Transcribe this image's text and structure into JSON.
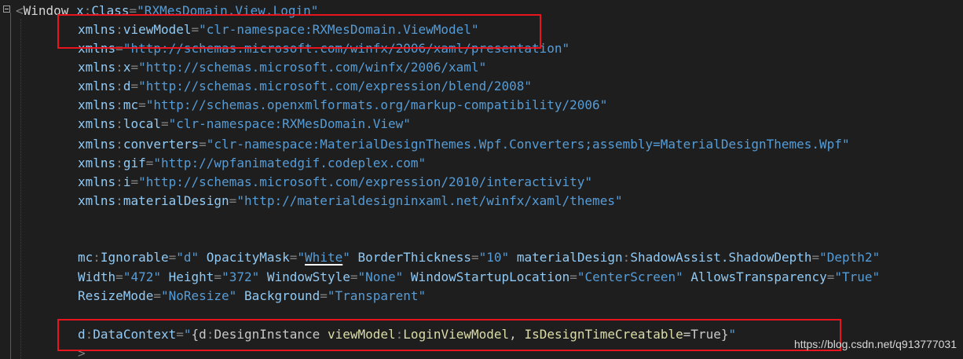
{
  "editor": {
    "first_line": {
      "open": "<",
      "element": "Window",
      "attr_prefix": "x",
      "colon": ":",
      "attr_name": "Class",
      "eq": "=",
      "value": "\"RXMesDomain.View.Login\""
    },
    "namespaces": [
      {
        "prefix": "xmlns",
        "name": "viewModel",
        "value": "\"clr-namespace:RXMesDomain.ViewModel\""
      },
      {
        "prefix": "xmlns",
        "name": "",
        "value": "\"http://schemas.microsoft.com/winfx/2006/xaml/presentation\""
      },
      {
        "prefix": "xmlns",
        "name": "x",
        "value": "\"http://schemas.microsoft.com/winfx/2006/xaml\""
      },
      {
        "prefix": "xmlns",
        "name": "d",
        "value": "\"http://schemas.microsoft.com/expression/blend/2008\""
      },
      {
        "prefix": "xmlns",
        "name": "mc",
        "value": "\"http://schemas.openxmlformats.org/markup-compatibility/2006\""
      },
      {
        "prefix": "xmlns",
        "name": "local",
        "value": "\"clr-namespace:RXMesDomain.View\""
      },
      {
        "prefix": "xmlns",
        "name": "converters",
        "value": "\"clr-namespace:MaterialDesignThemes.Wpf.Converters;assembly=MaterialDesignThemes.Wpf\""
      },
      {
        "prefix": "xmlns",
        "name": "gif",
        "value": "\"http://wpfanimatedgif.codeplex.com\""
      },
      {
        "prefix": "xmlns",
        "name": "i",
        "value": "\"http://schemas.microsoft.com/expression/2010/interactivity\""
      },
      {
        "prefix": "xmlns",
        "name": "materialDesign",
        "value": "\"http://materialdesigninxaml.net/winfx/xaml/themes\""
      }
    ],
    "props1": {
      "a1p": "mc",
      "a1n": "Ignorable",
      "a1v": "\"d\"",
      "a2n": "OpacityMask",
      "a2q1": "\"",
      "a2v": "White",
      "a2q2": "\"",
      "a3n": "BorderThickness",
      "a3v": "\"10\"",
      "a4p": "materialDesign",
      "a4n": "ShadowAssist.ShadowDepth",
      "a4v": "\"Depth2\""
    },
    "props2": {
      "a1n": "Width",
      "a1v": "\"472\"",
      "a2n": "Height",
      "a2v": "\"372\"",
      "a3n": "WindowStyle",
      "a3v": "\"None\"",
      "a4n": "WindowStartupLocation",
      "a4v": "\"CenterScreen\"",
      "a5n": "AllowsTransparency",
      "a5v": "\"True\""
    },
    "props3": {
      "a1n": "ResizeMode",
      "a1v": "\"NoResize\"",
      "a2n": "Background",
      "a2v": "\"Transparent\""
    },
    "datacontext": {
      "prefix": "d",
      "name": "DataContext",
      "eq": "=",
      "q1": "\"",
      "open": "{",
      "ext_prefix": "d",
      "ext_name": "DesignInstance",
      "type_prefix": "viewModel",
      "type_name": "LoginViewModel",
      "comma": ",",
      "prop_name": "IsDesignTimeCreatable",
      "prop_eq": "=",
      "prop_val": "True",
      "close": "}",
      "q2": "\""
    },
    "last_line": ">"
  },
  "watermark": "https://blog.csdn.net/q913777031",
  "colors": {
    "background": "#1e1e1e",
    "attribute": "#92caf4",
    "value": "#569cd6",
    "highlight_box": "#e8141e"
  }
}
